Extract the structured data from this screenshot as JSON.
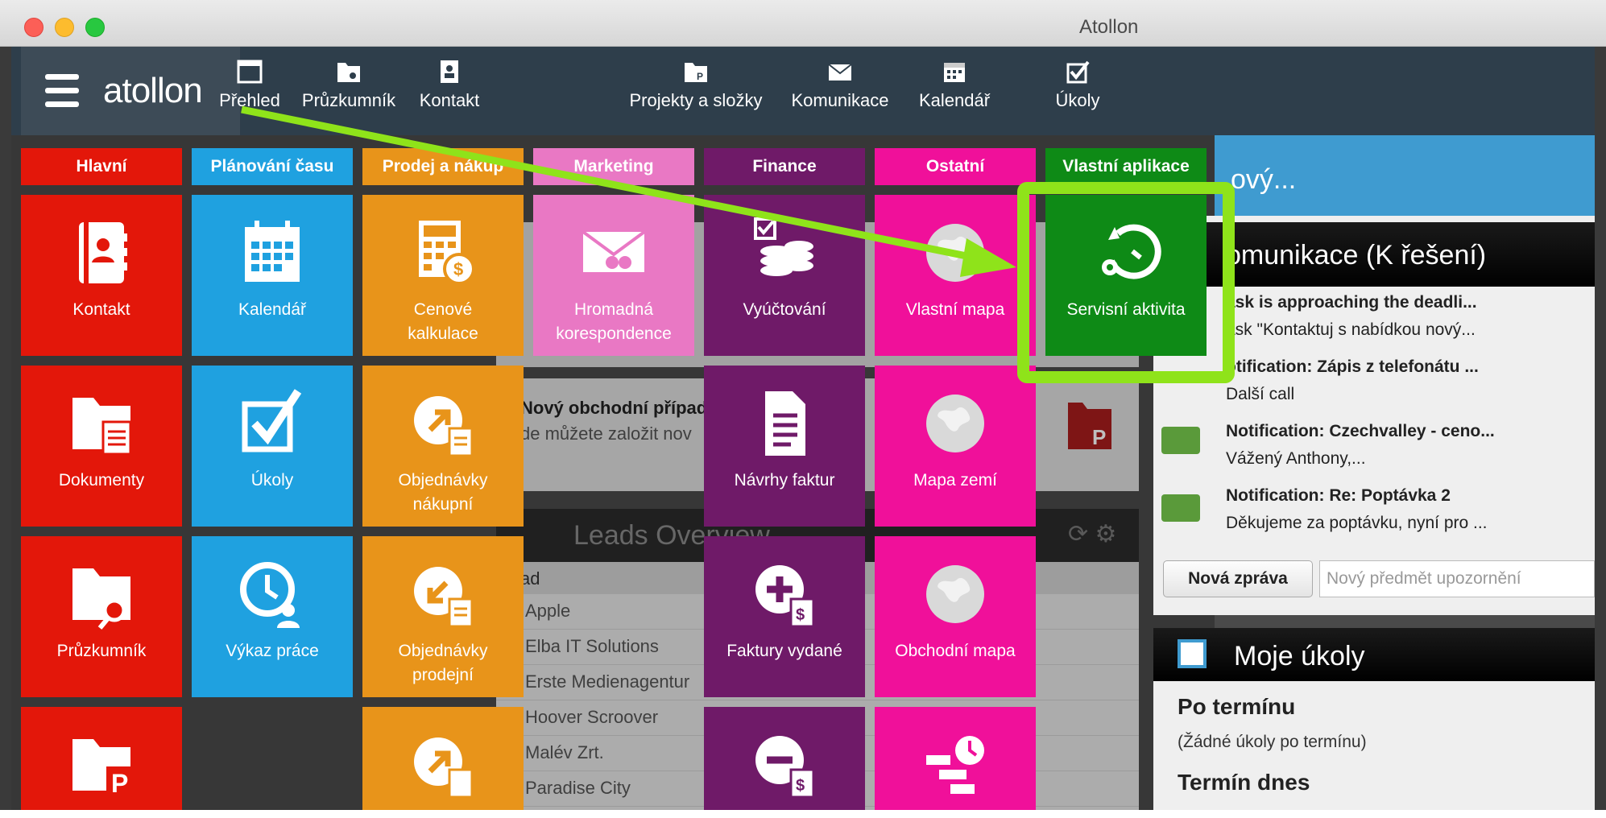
{
  "window": {
    "title": "Atollon"
  },
  "brand": {
    "logo": "atollon"
  },
  "nav": [
    {
      "label": "Přehled",
      "icon": "window-icon"
    },
    {
      "label": "Průzkumník",
      "icon": "folder-search-icon"
    },
    {
      "label": "Kontakt",
      "icon": "contact-card-icon"
    },
    {
      "label": "Projekty a složky",
      "icon": "project-folder-icon"
    },
    {
      "label": "Komunikace",
      "icon": "envelope-icon"
    },
    {
      "label": "Kalendář",
      "icon": "calendar-icon"
    },
    {
      "label": "Úkoly",
      "icon": "checkbox-icon"
    }
  ],
  "categories": [
    {
      "label": "Hlavní",
      "color": "#e3170a"
    },
    {
      "label": "Plánování času",
      "color": "#1fa1e0"
    },
    {
      "label": "Prodej a nákup",
      "color": "#e8941a"
    },
    {
      "label": "Marketing",
      "color": "#e978c4"
    },
    {
      "label": "Finance",
      "color": "#6f1a68"
    },
    {
      "label": "Ostatní",
      "color": "#f0109a"
    },
    {
      "label": "Vlastní aplikace",
      "color": "#0e8a16"
    }
  ],
  "tiles": {
    "kontakt": "Kontakt",
    "kalendar": "Kalendář",
    "cenove": [
      "Cenové",
      "kalkulace"
    ],
    "hromadna": [
      "Hromadná",
      "korespondence"
    ],
    "vyuctovani": "Vyúčtování",
    "vlastni_mapa": "Vlastní mapa",
    "servisni": "Servisní aktivita",
    "dokumenty": "Dokumenty",
    "ukoly": "Úkoly",
    "obj_nakupni": [
      "Objednávky",
      "nákupní"
    ],
    "navrhy": "Návrhy faktur",
    "mapa_zemi": "Mapa zemí",
    "pruzkumnik": "Průzkumník",
    "vykaz": "Výkaz práce",
    "obj_prodejni": [
      "Objednávky",
      "prodejní"
    ],
    "faktury": "Faktury vydané",
    "obchodni_mapa": "Obchodní mapa"
  },
  "right_panel": {
    "header": "ový...",
    "komunikace_title": "omunikace (K řešení)",
    "notifications": [
      {
        "title": "ask is approaching the deadli...",
        "body": "ask \"Kontaktuj s nabídkou nový..."
      },
      {
        "title": "otification: Zápis z telefonátu ...",
        "body": "Další call"
      },
      {
        "title": "Notification: Czechvalley - ceno...",
        "body": "Vážený Anthony,..."
      },
      {
        "title": "Notification: Re: Poptávka 2",
        "body": "Děkujeme za poptávku, nyní pro ..."
      }
    ],
    "new_message_button": "Nová zpráva",
    "new_subject_placeholder": "Nový předmět upozornění",
    "tasks_title": "Moje úkoly",
    "overdue_heading": "Po termínu",
    "overdue_empty": "(Žádné úkoly po termínu)",
    "today_heading": "Termín dnes"
  },
  "background": {
    "new_case_title": "Nový obchodní případ",
    "new_case_body": "de můžete založit nov",
    "leads_title": "Leads Overview",
    "leads_col": "ad",
    "leads": [
      "Apple",
      "Elba IT Solutions",
      "Erste Medienagentur",
      "Hoover Scroover",
      "Malév Zrt.",
      "Paradise City"
    ]
  },
  "colors": {
    "highlight": "#8fe31a",
    "navbar": "#2e3e4b"
  }
}
